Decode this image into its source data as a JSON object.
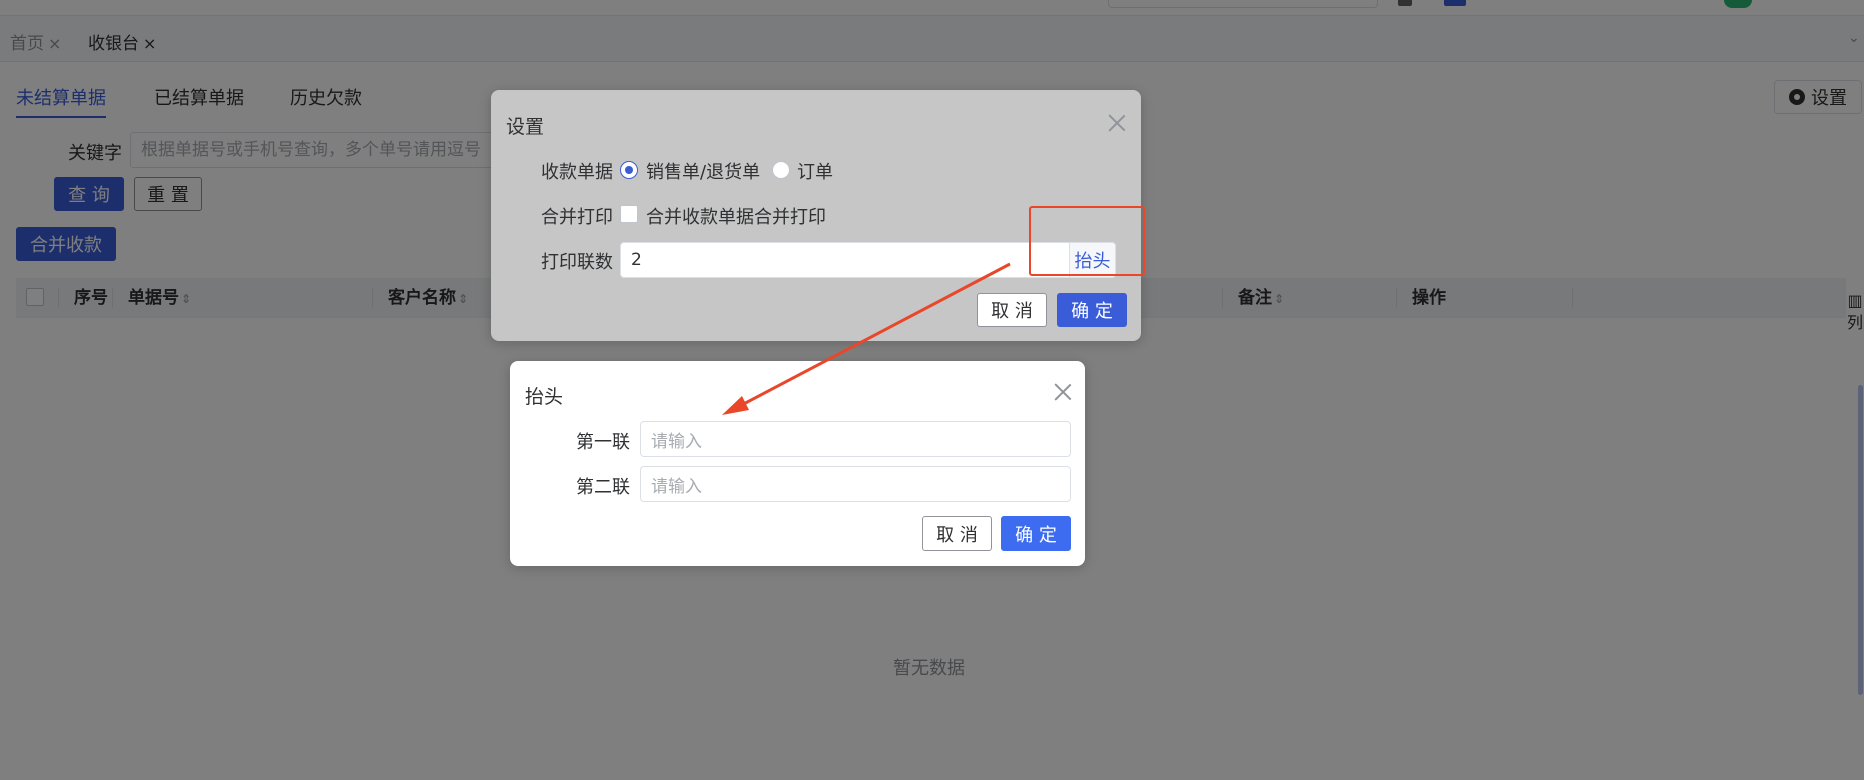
{
  "tabs": [
    {
      "label": "首页",
      "close": "×"
    },
    {
      "label": "收银台",
      "close": "×"
    }
  ],
  "subtabs": [
    "未结算单据",
    "已结算单据",
    "历史欠款"
  ],
  "settings_button": "设置",
  "search": {
    "label": "关键字",
    "placeholder": "根据单据号或手机号查询，多个单号请用逗号"
  },
  "buttons": {
    "query": "查 询",
    "reset": "重 置",
    "merge": "合并收款"
  },
  "table": {
    "columns": [
      "序号",
      "单据号",
      "客户名称",
      "备注",
      "操作"
    ],
    "empty": "暂无数据",
    "column_control": [
      "▥",
      "列"
    ]
  },
  "settings_dialog": {
    "title": "设置",
    "receipt_label": "收款单据",
    "receipt_options": [
      "销售单/退货单",
      "订单"
    ],
    "receipt_selected": "销售单/退货单",
    "merge_print_label": "合并打印",
    "merge_print_option": "合并收款单据合并打印",
    "merge_print_checked": false,
    "copies_label": "打印联数",
    "copies_value": "2",
    "header_button": "抬头",
    "cancel": "取 消",
    "confirm": "确 定"
  },
  "header_dialog": {
    "title": "抬头",
    "first_label": "第一联",
    "first_placeholder": "请输入",
    "second_label": "第二联",
    "second_placeholder": "请输入",
    "cancel": "取 消",
    "confirm": "确 定"
  },
  "colors": {
    "primary": "#3a5cd8",
    "annotation": "#e8472a"
  }
}
